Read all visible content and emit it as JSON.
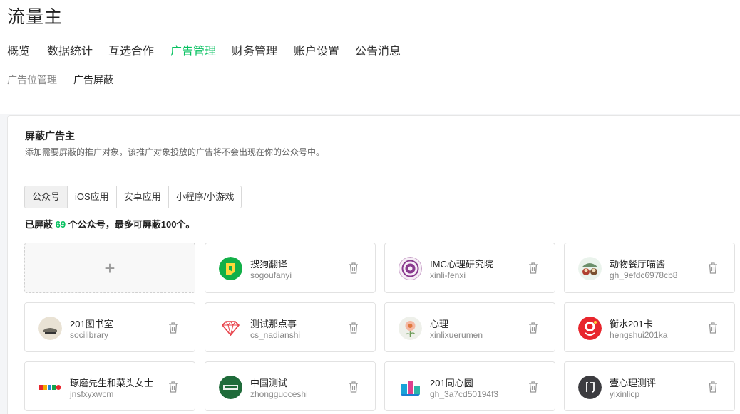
{
  "app": {
    "title": "流量主"
  },
  "nav": {
    "items": [
      "概览",
      "数据统计",
      "互选合作",
      "广告管理",
      "财务管理",
      "账户设置",
      "公告消息"
    ],
    "active_index": 3
  },
  "subnav": {
    "items": [
      "广告位管理",
      "广告屏蔽"
    ],
    "active_index": 1
  },
  "block": {
    "title": "屏蔽广告主",
    "description": "添加需要屏蔽的推广对象，该推广对象投放的广告将不会出现在你的公众号中。",
    "tabs": [
      "公众号",
      "iOS应用",
      "安卓应用",
      "小程序/小游戏"
    ],
    "active_tab": 0,
    "count_prefix": "已屏蔽",
    "count": "69",
    "count_suffix": "个公众号，最多可屏蔽100个。",
    "add_label": "+"
  },
  "accounts": [
    {
      "name": "搜狗翻译",
      "handle": "sogoufanyi",
      "icon": "sogou-translate-logo"
    },
    {
      "name": "IMC心理研究院",
      "handle": "xinli-fenxi",
      "icon": "imc-logo"
    },
    {
      "name": "动物餐厅喵酱",
      "handle": "gh_9efdc6978cb8",
      "icon": "cat-restaurant-logo"
    },
    {
      "name": "201图书室",
      "handle": "socilibrary",
      "icon": "library-logo"
    },
    {
      "name": "测试那点事",
      "handle": "cs_nadianshi",
      "icon": "diamond-logo"
    },
    {
      "name": "心理",
      "handle": "xinlixuerumen",
      "icon": "flower-logo"
    },
    {
      "name": "衡水201卡",
      "handle": "hengshui201ka",
      "icon": "hengshui-logo"
    },
    {
      "name": "琢磨先生和菜头女士",
      "handle": "jnsfxyxwcm",
      "icon": "radio-logo"
    },
    {
      "name": "中国测试",
      "handle": "zhongguoceshi",
      "icon": "china-test-logo"
    },
    {
      "name": "201同心圆",
      "handle": "gh_3a7cd50194f3",
      "icon": "tongxinyuan-logo"
    },
    {
      "name": "壹心理测评",
      "handle": "yixinlicp",
      "icon": "yixinli-logo"
    }
  ],
  "colors": {
    "accent": "#07c160"
  }
}
